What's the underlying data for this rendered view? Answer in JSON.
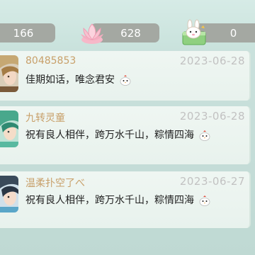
{
  "stats": {
    "left_value": "166",
    "mid_value": "628",
    "right_value": "0"
  },
  "messages": [
    {
      "name": "80485853",
      "date": "2023-06-28",
      "text": "佳期如话，唯念君安"
    },
    {
      "name": "九转灵童",
      "date": "2023-06-28",
      "text": "祝有良人相伴，跨万水千山，粽情四海"
    },
    {
      "name": "温柔扑空了べ",
      "date": "2023-06-27",
      "text": "祝有良人相伴，跨万水千山，粽情四海"
    }
  ],
  "colors": {
    "name": "#c8a06a",
    "date": "#c2c2c2",
    "pill": "#a4a8a2"
  },
  "icons": {
    "mid_stat": "lotus-icon",
    "right_stat": "rabbit-icon",
    "emote": "chicken-emote-icon"
  }
}
